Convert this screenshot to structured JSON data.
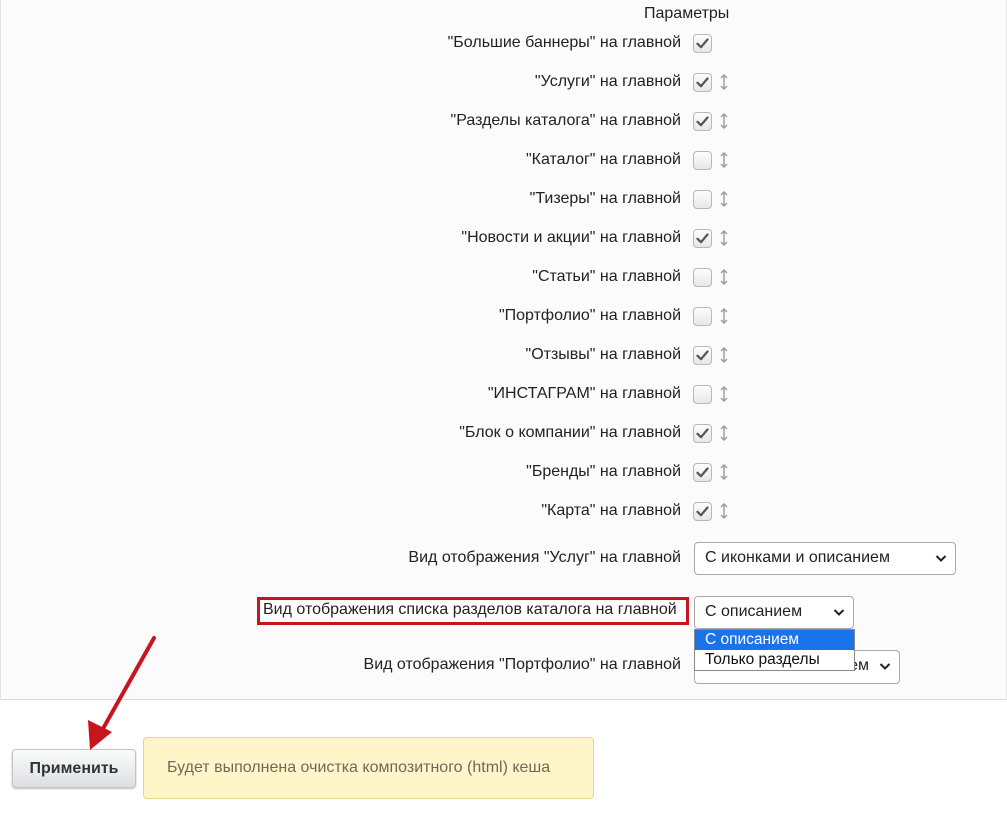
{
  "panel": {
    "title": "Параметры",
    "checkbox_rows": [
      {
        "label": "\"Большие баннеры\" на главной",
        "checked": true,
        "draggable": false
      },
      {
        "label": "\"Услуги\" на главной",
        "checked": true,
        "draggable": true
      },
      {
        "label": "\"Разделы каталога\" на главной",
        "checked": true,
        "draggable": true
      },
      {
        "label": "\"Каталог\" на главной",
        "checked": false,
        "draggable": true
      },
      {
        "label": "\"Тизеры\" на главной",
        "checked": false,
        "draggable": true
      },
      {
        "label": "\"Новости и акции\" на главной",
        "checked": true,
        "draggable": true
      },
      {
        "label": "\"Статьи\" на главной",
        "checked": false,
        "draggable": true
      },
      {
        "label": "\"Портфолио\" на главной",
        "checked": false,
        "draggable": true
      },
      {
        "label": "\"Отзывы\" на главной",
        "checked": true,
        "draggable": true
      },
      {
        "label": "\"ИНСТАГРАМ\" на главной",
        "checked": false,
        "draggable": true
      },
      {
        "label": "\"Блок о компании\" на главной",
        "checked": true,
        "draggable": true
      },
      {
        "label": "\"Бренды\" на главной",
        "checked": true,
        "draggable": true
      },
      {
        "label": "\"Карта\" на главной",
        "checked": true,
        "draggable": true
      }
    ],
    "view_services": {
      "label": "Вид отображения \"Услуг\" на главной",
      "value": "С иконками и описанием"
    },
    "view_catalog_sections": {
      "label": "Вид отображения списка разделов каталога на главной",
      "value": "С описанием",
      "options": [
        "С описанием",
        "Только разделы"
      ],
      "highlighted_option": "С описанием"
    },
    "view_portfolio": {
      "label": "Вид отображения \"Портфолио\" на главной",
      "value_visible_tail": "ем"
    }
  },
  "footer": {
    "apply_label": "Применить",
    "notice": "Будет выполнена очистка композитного (html) кеша"
  },
  "colors": {
    "highlight_border": "#c8141c",
    "option_active_bg": "#1a73e8",
    "notice_bg": "#fef6c8",
    "arrow": "#c8141c"
  },
  "icons": {
    "checkbox_check": "check-icon",
    "drag_handle": "up-down-arrow-icon",
    "select_chevron": "chevron-down-icon",
    "annotation_arrow": "arrow-icon"
  }
}
